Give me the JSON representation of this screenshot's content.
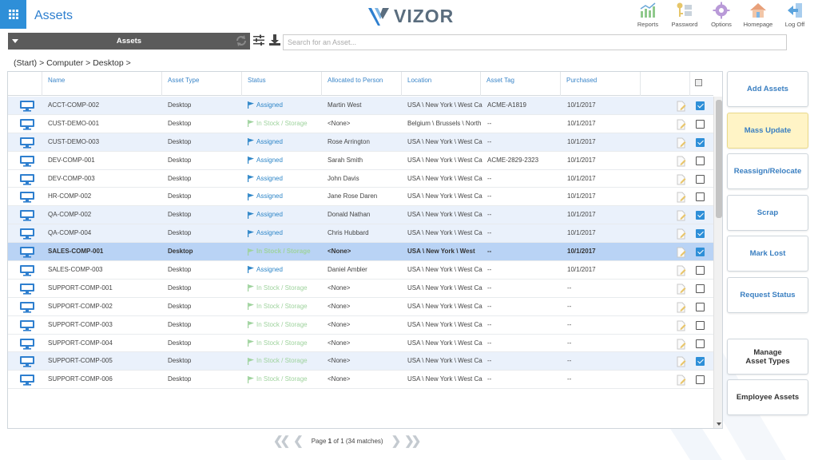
{
  "header": {
    "title": "Assets",
    "logo_text": "VIZOR",
    "nav": [
      {
        "label": "Reports",
        "icon": "reports-icon"
      },
      {
        "label": "Password",
        "icon": "password-icon"
      },
      {
        "label": "Options",
        "icon": "options-icon"
      },
      {
        "label": "Homepage",
        "icon": "homepage-icon"
      },
      {
        "label": "Log Off",
        "icon": "logoff-icon"
      }
    ]
  },
  "toolbar": {
    "asset_select": "Assets",
    "search_placeholder": "Search for an Asset..."
  },
  "breadcrumb": "(Start) > Computer > Desktop >",
  "grid": {
    "columns": [
      "Name",
      "Asset Type",
      "Status",
      "Allocated to Person",
      "Location",
      "Asset Tag",
      "Purchased"
    ],
    "rows": [
      {
        "name": "ACCT-COMP-002",
        "type": "Desktop",
        "status": "Assigned",
        "person": "Martin West",
        "location": "USA \\ New York \\ West Ca",
        "tag": "ACME-A1819",
        "purchased": "10/1/2017",
        "checked": true,
        "style": "alt"
      },
      {
        "name": "CUST-DEMO-001",
        "type": "Desktop",
        "status": "In Stock / Storage",
        "person": "<None>",
        "location": "Belgium \\ Brussels \\ North",
        "tag": "--",
        "purchased": "10/1/2017",
        "checked": false,
        "style": ""
      },
      {
        "name": "CUST-DEMO-003",
        "type": "Desktop",
        "status": "Assigned",
        "person": "Rose Arrington",
        "location": "USA \\ New York \\ West Ca",
        "tag": "--",
        "purchased": "10/1/2017",
        "checked": true,
        "style": "alt"
      },
      {
        "name": "DEV-COMP-001",
        "type": "Desktop",
        "status": "Assigned",
        "person": "Sarah Smith",
        "location": "USA \\ New York \\ West Ca",
        "tag": "ACME-2829-2323",
        "purchased": "10/1/2017",
        "checked": false,
        "style": ""
      },
      {
        "name": "DEV-COMP-003",
        "type": "Desktop",
        "status": "Assigned",
        "person": "John Davis",
        "location": "USA \\ New York \\ West Ca",
        "tag": "--",
        "purchased": "10/1/2017",
        "checked": false,
        "style": ""
      },
      {
        "name": "HR-COMP-002",
        "type": "Desktop",
        "status": "Assigned",
        "person": "Jane Rose Daren",
        "location": "USA \\ New York \\ West Ca",
        "tag": "--",
        "purchased": "10/1/2017",
        "checked": false,
        "style": ""
      },
      {
        "name": "QA-COMP-002",
        "type": "Desktop",
        "status": "Assigned",
        "person": "Donald Nathan",
        "location": "USA \\ New York \\ West Ca",
        "tag": "--",
        "purchased": "10/1/2017",
        "checked": true,
        "style": "alt"
      },
      {
        "name": "QA-COMP-004",
        "type": "Desktop",
        "status": "Assigned",
        "person": "Chris Hubbard",
        "location": "USA \\ New York \\ West Ca",
        "tag": "--",
        "purchased": "10/1/2017",
        "checked": true,
        "style": "alt"
      },
      {
        "name": "SALES-COMP-001",
        "type": "Desktop",
        "status": "In Stock / Storage",
        "person": "<None>",
        "location": "USA \\ New York \\ West",
        "tag": "--",
        "purchased": "10/1/2017",
        "checked": true,
        "style": "sel"
      },
      {
        "name": "SALES-COMP-003",
        "type": "Desktop",
        "status": "Assigned",
        "person": "Daniel Ambler",
        "location": "USA \\ New York \\ West Ca",
        "tag": "--",
        "purchased": "10/1/2017",
        "checked": false,
        "style": ""
      },
      {
        "name": "SUPPORT-COMP-001",
        "type": "Desktop",
        "status": "In Stock / Storage",
        "person": "<None>",
        "location": "USA \\ New York \\ West Ca",
        "tag": "--",
        "purchased": "--",
        "checked": false,
        "style": ""
      },
      {
        "name": "SUPPORT-COMP-002",
        "type": "Desktop",
        "status": "In Stock / Storage",
        "person": "<None>",
        "location": "USA \\ New York \\ West Ca",
        "tag": "--",
        "purchased": "--",
        "checked": false,
        "style": ""
      },
      {
        "name": "SUPPORT-COMP-003",
        "type": "Desktop",
        "status": "In Stock / Storage",
        "person": "<None>",
        "location": "USA \\ New York \\ West Ca",
        "tag": "--",
        "purchased": "--",
        "checked": false,
        "style": ""
      },
      {
        "name": "SUPPORT-COMP-004",
        "type": "Desktop",
        "status": "In Stock / Storage",
        "person": "<None>",
        "location": "USA \\ New York \\ West Ca",
        "tag": "--",
        "purchased": "--",
        "checked": false,
        "style": ""
      },
      {
        "name": "SUPPORT-COMP-005",
        "type": "Desktop",
        "status": "In Stock / Storage",
        "person": "<None>",
        "location": "USA \\ New York \\ West Ca",
        "tag": "--",
        "purchased": "--",
        "checked": true,
        "style": "alt"
      },
      {
        "name": "SUPPORT-COMP-006",
        "type": "Desktop",
        "status": "In Stock / Storage",
        "person": "<None>",
        "location": "USA \\ New York \\ West Ca",
        "tag": "--",
        "purchased": "--",
        "checked": false,
        "style": ""
      }
    ]
  },
  "pager": {
    "prefix": "Page",
    "page": "1",
    "suffix": "of 1 (34 matches)"
  },
  "actions": [
    {
      "label": "Add Assets",
      "name": "add-assets-button",
      "style": ""
    },
    {
      "label": "Mass Update",
      "name": "mass-update-button",
      "style": "hl"
    },
    {
      "label": "Reassign/Relocate",
      "name": "reassign-relocate-button",
      "style": ""
    },
    {
      "label": "Scrap",
      "name": "scrap-button",
      "style": ""
    },
    {
      "label": "Mark Lost",
      "name": "mark-lost-button",
      "style": ""
    },
    {
      "label": "Request Status",
      "name": "request-status-button",
      "style": ""
    },
    {
      "label": "Manage Asset Types",
      "name": "manage-asset-types-button",
      "style": "dark"
    },
    {
      "label": "Employee Assets",
      "name": "employee-assets-button",
      "style": "dark"
    }
  ],
  "colors": {
    "accent": "#2e8fd8",
    "assigned": "#2e86c8",
    "in_stock": "#9fd39e",
    "selected_row": "#b9d3f5",
    "highlight_button": "#fff4c6"
  }
}
